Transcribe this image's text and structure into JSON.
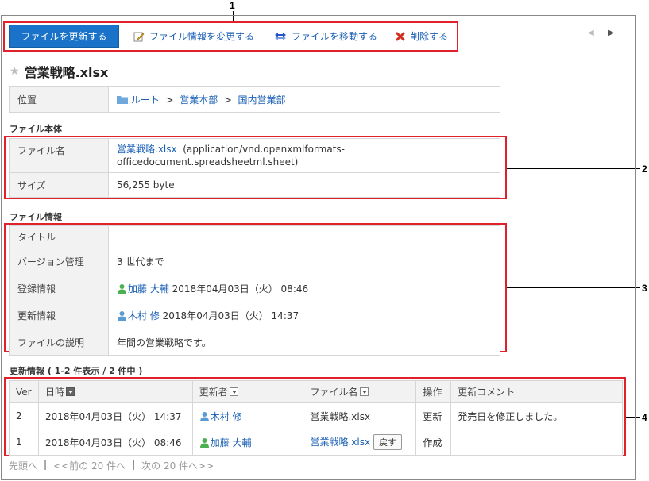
{
  "callouts": [
    "1",
    "2",
    "3",
    "4"
  ],
  "toolbar": {
    "update_file": "ファイルを更新する",
    "change_info": "ファイル情報を変更する",
    "move_file": "ファイルを移動する",
    "delete": "削除する"
  },
  "nav": {
    "prev": "◀",
    "next": "▶"
  },
  "file_title": "営業戦略.xlsx",
  "location": {
    "label": "位置",
    "root": "ルート",
    "sep": ">",
    "folder1": "営業本部",
    "folder2": "国内営業部"
  },
  "file_body": {
    "heading": "ファイル本体",
    "name_label": "ファイル名",
    "file_link": "営業戦略.xlsx",
    "mime_line1": "(application/vnd.openxmlformats-",
    "mime_line2": "officedocument.spreadsheetml.sheet)",
    "size_label": "サイズ",
    "size_value": "56,255 byte"
  },
  "file_info": {
    "heading": "ファイル情報",
    "title_label": "タイトル",
    "title_value": "",
    "version_label": "バージョン管理",
    "version_value": "3 世代まで",
    "registered_label": "登録情報",
    "registered_user": "加藤 大輔",
    "registered_date": "2018年04月03日（火） 08:46",
    "updated_label": "更新情報",
    "updated_user": "木村 修",
    "updated_date": "2018年04月03日（火） 14:37",
    "desc_label": "ファイルの説明",
    "desc_value": "年間の営業戦略です。"
  },
  "history": {
    "heading": "更新情報 ( 1-2 件表示 / 2 件中 )",
    "columns": [
      "Ver",
      "日時",
      "更新者",
      "ファイル名",
      "操作",
      "更新コメント"
    ],
    "rows": [
      {
        "ver": "2",
        "date": "2018年04月03日（火） 14:37",
        "user": "木村 修",
        "file": "営業戦略.xlsx",
        "op": "更新",
        "comment": "発売日を修正しました。"
      },
      {
        "ver": "1",
        "date": "2018年04月03日（火） 08:46",
        "user": "加藤 大輔",
        "file": "営業戦略.xlsx",
        "revert": "戻す",
        "op": "作成",
        "comment": ""
      }
    ]
  },
  "pager": {
    "first": "先頭へ",
    "sep": "|",
    "prev": "<<前の 20 件へ",
    "next": "次の 20 件へ>>"
  },
  "colors": {
    "red_frame": "#e0202a",
    "primary": "#1a73c8",
    "link": "#1a5fb4"
  }
}
